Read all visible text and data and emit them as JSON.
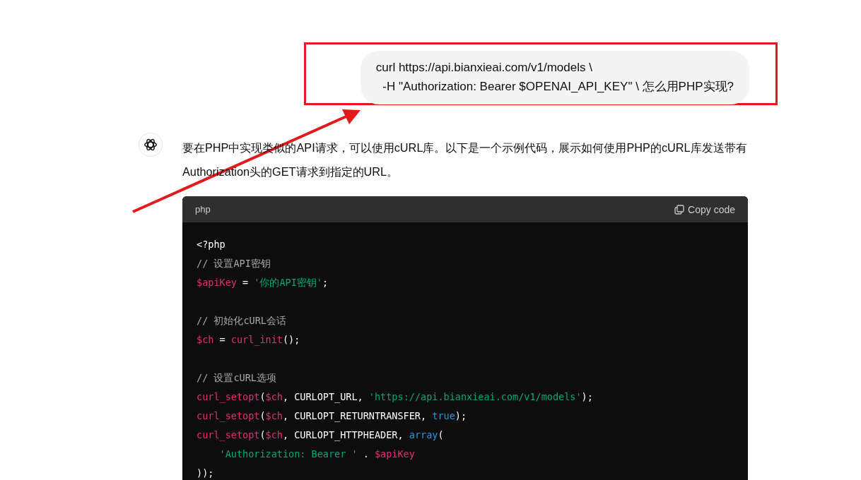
{
  "user_message": {
    "text": "curl https://api.bianxieai.com/v1/models \\\n  -H \"Authorization: Bearer $OPENAI_API_KEY\" \\ 怎么用PHP实现?"
  },
  "assistant_message": {
    "text": "要在PHP中实现类似的API请求，可以使用cURL库。以下是一个示例代码，展示如何使用PHP的cURL库发送带有Authorization头的GET请求到指定的URL。"
  },
  "code_block": {
    "language": "php",
    "copy_label": "Copy code",
    "lines": [
      {
        "kind": "code",
        "tokens": [
          {
            "kind": "plain",
            "text": "<?php"
          }
        ]
      },
      {
        "kind": "code",
        "tokens": [
          {
            "kind": "comment",
            "text": "// 设置API密钥"
          }
        ]
      },
      {
        "kind": "code",
        "tokens": [
          {
            "kind": "variable",
            "text": "$apiKey"
          },
          {
            "kind": "plain",
            "text": " = "
          },
          {
            "kind": "string",
            "text": "'你的API密钥'"
          },
          {
            "kind": "plain",
            "text": ";"
          }
        ]
      },
      {
        "kind": "blank"
      },
      {
        "kind": "code",
        "tokens": [
          {
            "kind": "comment",
            "text": "// 初始化cURL会话"
          }
        ]
      },
      {
        "kind": "code",
        "tokens": [
          {
            "kind": "variable",
            "text": "$ch"
          },
          {
            "kind": "plain",
            "text": " = "
          },
          {
            "kind": "function",
            "text": "curl_init"
          },
          {
            "kind": "plain",
            "text": "();"
          }
        ]
      },
      {
        "kind": "blank"
      },
      {
        "kind": "code",
        "tokens": [
          {
            "kind": "comment",
            "text": "// 设置cURL选项"
          }
        ]
      },
      {
        "kind": "code",
        "tokens": [
          {
            "kind": "function",
            "text": "curl_setopt"
          },
          {
            "kind": "plain",
            "text": "("
          },
          {
            "kind": "variable",
            "text": "$ch"
          },
          {
            "kind": "plain",
            "text": ", CURLOPT_URL, "
          },
          {
            "kind": "string",
            "text": "'https://api.bianxieai.com/v1/models'"
          },
          {
            "kind": "plain",
            "text": ");"
          }
        ]
      },
      {
        "kind": "code",
        "tokens": [
          {
            "kind": "function",
            "text": "curl_setopt"
          },
          {
            "kind": "plain",
            "text": "("
          },
          {
            "kind": "variable",
            "text": "$ch"
          },
          {
            "kind": "plain",
            "text": ", CURLOPT_RETURNTRANSFER, "
          },
          {
            "kind": "keyword",
            "text": "true"
          },
          {
            "kind": "plain",
            "text": ");"
          }
        ]
      },
      {
        "kind": "code",
        "tokens": [
          {
            "kind": "function",
            "text": "curl_setopt"
          },
          {
            "kind": "plain",
            "text": "("
          },
          {
            "kind": "variable",
            "text": "$ch"
          },
          {
            "kind": "plain",
            "text": ", CURLOPT_HTTPHEADER, "
          },
          {
            "kind": "keyword",
            "text": "array"
          },
          {
            "kind": "plain",
            "text": "("
          }
        ]
      },
      {
        "kind": "code",
        "tokens": [
          {
            "kind": "string",
            "text": "    'Authorization: Bearer '"
          },
          {
            "kind": "plain",
            "text": " . "
          },
          {
            "kind": "variable",
            "text": "$apiKey"
          }
        ]
      },
      {
        "kind": "code",
        "tokens": [
          {
            "kind": "plain",
            "text": "));"
          }
        ]
      }
    ]
  }
}
